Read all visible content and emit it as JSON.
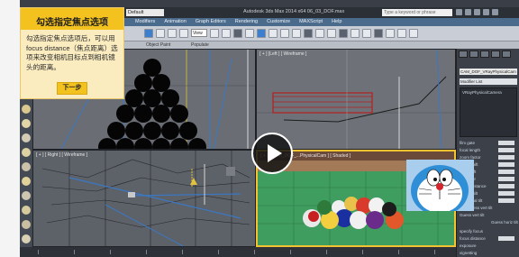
{
  "titlebar": {
    "workspace_value": "Default",
    "app_title": "Autodesk 3ds Max 2014 x64   06_03_DOF.max",
    "search_placeholder": "Type a keyword or phrase"
  },
  "menubar": {
    "items": [
      "Modifiers",
      "Animation",
      "Graph Editors",
      "Rendering",
      "Customize",
      "MAXScript",
      "Help"
    ]
  },
  "toolbar": {
    "view_dropdown": "View"
  },
  "ribbon": {
    "object_paint": "Object Paint",
    "populate": "Populate"
  },
  "viewports": {
    "top_left_label": "",
    "top_right_label": "[ + ] [Left ] [ Wireframe ]",
    "bottom_left_label": "[ + ] [ Right ] [ Wireframe ]",
    "bottom_right_label": "[ + ] [ CAM_DOF_...PhysicalCam ] [ Shaded ]"
  },
  "command_panel": {
    "object_name": "CAM_DOF_VRayPhysicalCam",
    "modifier_list": "Modifier List",
    "stack_item": "VRayPhysicalCamera",
    "params": [
      "film gate",
      "focal length",
      "zoom factor",
      "horiz. shift",
      "vert. shift",
      "f-number",
      "target distance",
      "vertical tilt",
      "horizontal tilt",
      "auto guess vert tilt",
      "Guess vert tilt",
      "specify focus",
      "focus distance",
      "exposure",
      "vignetting"
    ],
    "guess_horiz": "Guess horiz tilt"
  },
  "tutorial": {
    "title": "勾选指定焦点选项",
    "body": "勾选指定焦点选项后，可以用focus distance（焦点距离）选项来改变相机目标点到相机镜头的距离。",
    "next_label": "下一步"
  },
  "player": {
    "play_icon": "play-icon"
  },
  "colors": {
    "tutorial_header": "#f4c21f",
    "tutorial_bg": "#fbecc0",
    "viewport_active": "#f2c230",
    "ground_green": "#3f9d5f"
  }
}
